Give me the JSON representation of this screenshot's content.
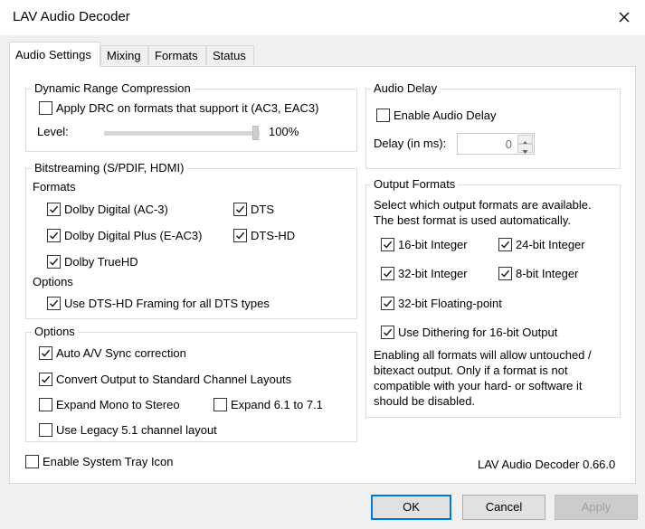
{
  "window": {
    "title": "LAV Audio Decoder",
    "close_icon": "close-icon"
  },
  "tabs": [
    "Audio Settings",
    "Mixing",
    "Formats",
    "Status"
  ],
  "drc": {
    "title": "Dynamic Range Compression",
    "apply_label": "Apply DRC on formats that support it (AC3, EAC3)",
    "apply_checked": false,
    "level_label": "Level:",
    "level_value": "100%",
    "level_fraction": 1.0
  },
  "bitstreaming": {
    "title": "Bitstreaming (S/PDIF, HDMI)",
    "formats_label": "Formats",
    "formats": [
      {
        "label": "Dolby Digital (AC-3)",
        "checked": true
      },
      {
        "label": "DTS",
        "checked": true
      },
      {
        "label": "Dolby Digital Plus (E-AC3)",
        "checked": true
      },
      {
        "label": "DTS-HD",
        "checked": true
      },
      {
        "label": "Dolby TrueHD",
        "checked": true
      }
    ],
    "options_label": "Options",
    "dts_framing_label": "Use DTS-HD Framing for all DTS types",
    "dts_framing_checked": true
  },
  "options": {
    "title": "Options",
    "items": [
      {
        "label": "Auto A/V Sync correction",
        "checked": true
      },
      {
        "label": "Convert Output to Standard Channel Layouts",
        "checked": true
      },
      {
        "label": "Expand Mono to Stereo",
        "checked": false
      },
      {
        "label": "Expand 6.1 to 7.1",
        "checked": false
      },
      {
        "label": "Use Legacy 5.1 channel layout",
        "checked": false
      }
    ]
  },
  "audio_delay": {
    "title": "Audio Delay",
    "enable_label": "Enable Audio Delay",
    "enable_checked": false,
    "delay_label": "Delay (in ms):",
    "delay_value": "0"
  },
  "output_formats": {
    "title": "Output Formats",
    "description_line1": "Select which output formats are available.",
    "description_line2": "The best format is used automatically.",
    "formats": [
      {
        "label": "16-bit Integer",
        "checked": true
      },
      {
        "label": "24-bit Integer",
        "checked": true
      },
      {
        "label": "32-bit Integer",
        "checked": true
      },
      {
        "label": "8-bit Integer",
        "checked": true
      },
      {
        "label": "32-bit Floating-point",
        "checked": true
      }
    ],
    "dithering_label": "Use Dithering for 16-bit Output",
    "dithering_checked": true,
    "note_lines": [
      "Enabling all formats will allow untouched /",
      "bitexact output. Only if a format is not",
      "compatible with your hard- or software it",
      "should be disabled."
    ]
  },
  "tray": {
    "label": "Enable System Tray Icon",
    "checked": false
  },
  "version": "LAV Audio Decoder 0.66.0",
  "buttons": {
    "ok": "OK",
    "cancel": "Cancel",
    "apply": "Apply"
  }
}
